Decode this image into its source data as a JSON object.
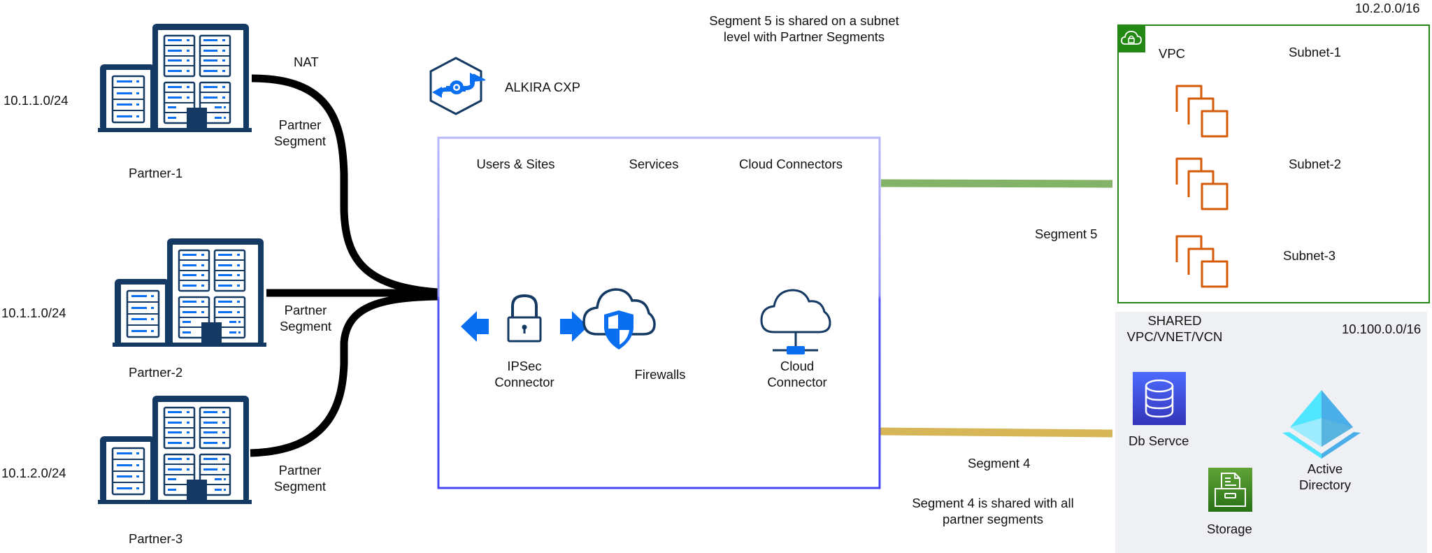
{
  "diagram": {
    "title": "ALKIRA CXP",
    "top_note": [
      "Segment 5  is shared on a subnet",
      "level  with Partner Segments"
    ],
    "partners": [
      {
        "name": "Partner-1",
        "subnet": "10.1.1.0/24",
        "link_label": [
          "Partner",
          "Segment"
        ],
        "extra_label": "NAT"
      },
      {
        "name": "Partner-2",
        "subnet": "10.1.1.0/24",
        "link_label": [
          "Partner",
          "Segment"
        ]
      },
      {
        "name": "Partner-3",
        "subnet": "10.1.2.0/24",
        "link_label": [
          "Partner",
          "Segment"
        ]
      }
    ],
    "cxp_columns": [
      {
        "header": "Users & Sites",
        "item": [
          "IPSec",
          "Connector"
        ],
        "icon": "ipsec-lock-arrows-icon"
      },
      {
        "header": "Services",
        "item": [
          "Firewalls"
        ],
        "icon": "cloud-shield-icon"
      },
      {
        "header": "Cloud Connectors",
        "item": [
          "Cloud",
          "Connector"
        ],
        "icon": "cloud-network-icon"
      }
    ],
    "segment5": {
      "label": "Segment 5",
      "color": "#82b366"
    },
    "segment4": {
      "label": "Segment 4",
      "note": [
        "Segment 4 is shared with all",
        "partner segments"
      ],
      "color": "#d6b656"
    },
    "vpc": {
      "label": "VPC",
      "cidr": "10.2.0.0/16",
      "subnets": [
        "Subnet-1",
        "Subnet-2",
        "Subnet-3"
      ],
      "border_color": "#248814",
      "instance_color": "#d45b07"
    },
    "shared": {
      "label": [
        "SHARED",
        "VPC/VNET/VCN"
      ],
      "cidr": "10.100.0.0/16",
      "services": {
        "db": "Db Servce",
        "storage": "Storage",
        "ad": [
          "Active",
          "Directory"
        ]
      },
      "bg_color": "#eff0f3"
    },
    "colors": {
      "building": "#143a64",
      "accent_blue": "#0a6ef0",
      "box_top": "#b3b3fa",
      "box_bottom": "#4b4bf0"
    }
  }
}
